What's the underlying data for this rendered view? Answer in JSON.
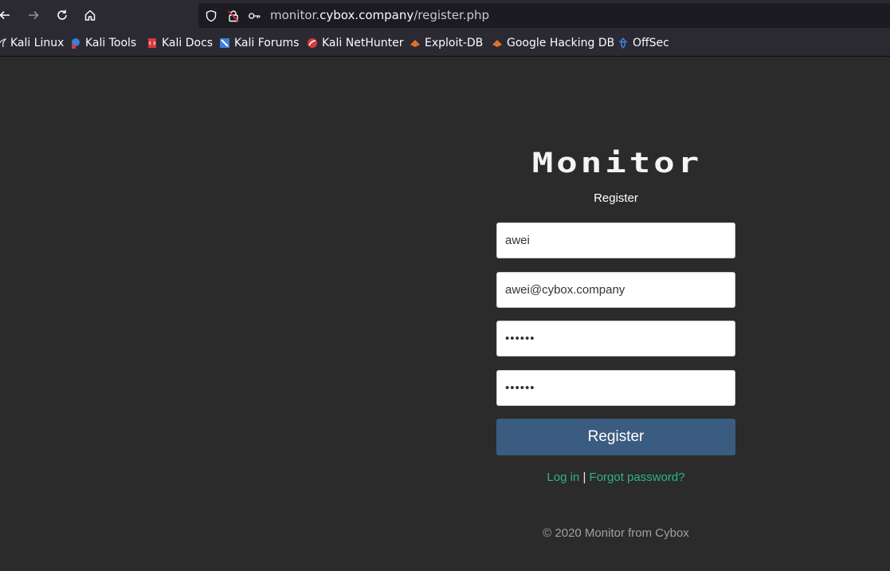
{
  "browser": {
    "url_host": "monitor.cybox.company",
    "url_path": "/register.php",
    "url_prefix": "monitor.",
    "url_domain": "cybox.company",
    "bookmarks": [
      {
        "label": "Kali Linux",
        "icon": "kali-dragon-icon",
        "color": "#cfcfcf"
      },
      {
        "label": "Kali Tools",
        "icon": "kali-tools-icon",
        "color": "#3d7fd9"
      },
      {
        "label": "Kali Docs",
        "icon": "kali-docs-icon",
        "color": "#d63c3c"
      },
      {
        "label": "Kali Forums",
        "icon": "kali-forums-icon",
        "color": "#3d7fd9"
      },
      {
        "label": "Kali NetHunter",
        "icon": "kali-nethunter-icon",
        "color": "#d63c3c"
      },
      {
        "label": "Exploit-DB",
        "icon": "exploit-db-icon",
        "color": "#e0702a"
      },
      {
        "label": "Google Hacking DB",
        "icon": "ghdb-icon",
        "color": "#e0702a"
      },
      {
        "label": "OffSec",
        "icon": "offsec-icon",
        "color": "#3d7fd9"
      }
    ]
  },
  "page": {
    "logo": "Monitor",
    "subtitle": "Register",
    "fields": {
      "username": "awei",
      "email": "awei@cybox.company",
      "password": "••••••",
      "confirm_password": "••••••"
    },
    "submit_label": "Register",
    "login_link": "Log in",
    "separator": "|",
    "forgot_link": "Forgot password?",
    "footer": "© 2020 Monitor from Cybox"
  },
  "colors": {
    "page_bg": "#2b2b2b",
    "button_bg": "#3b5c81",
    "link": "#2bb38f"
  }
}
